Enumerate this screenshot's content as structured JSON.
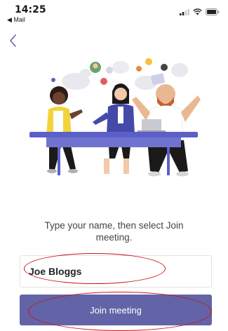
{
  "status_bar": {
    "time": "14:25",
    "back_app": "◀ Mail",
    "icons": [
      "signal-icon",
      "wifi-icon",
      "battery-icon"
    ]
  },
  "nav": {
    "back_icon": "chevron-left-icon"
  },
  "prompt_text": "Type your name, then select Join meeting.",
  "name_field": {
    "value": "Joe Bloggs"
  },
  "join_button": {
    "label": "Join meeting"
  },
  "colors": {
    "accent": "#6264a7",
    "annotation": "#d0101a"
  }
}
